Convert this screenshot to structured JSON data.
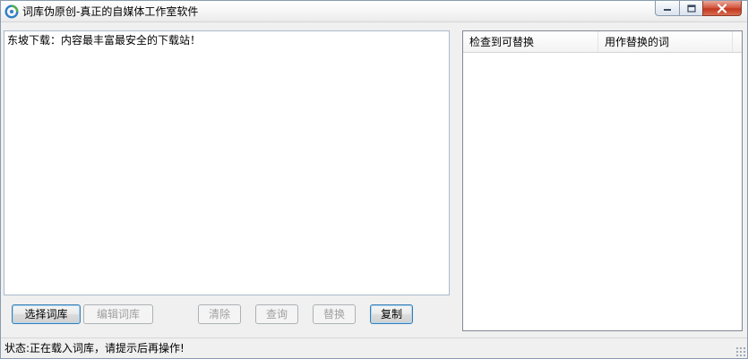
{
  "window": {
    "title": "词库伪原创-真正的自媒体工作室软件"
  },
  "editor": {
    "text": "东坡下载：内容最丰富最安全的下载站！"
  },
  "buttons": {
    "select_library": "选择词库",
    "edit_library": "编辑词库",
    "clear": "清除",
    "query": "查询",
    "replace": "替换",
    "copy": "复制"
  },
  "listview": {
    "columns": [
      "检查到可替换",
      "用作替换的词"
    ]
  },
  "statusbar": {
    "text": "状态:正在载入词库，请提示后再操作!"
  },
  "icons": {
    "app": "app-logo-icon",
    "minimize": "minimize-icon",
    "maximize": "maximize-icon",
    "close": "close-icon"
  },
  "colors": {
    "close_button": "#c9442b",
    "default_button_border": "#3c7fb1",
    "disabled_text": "#a0a0a0"
  }
}
